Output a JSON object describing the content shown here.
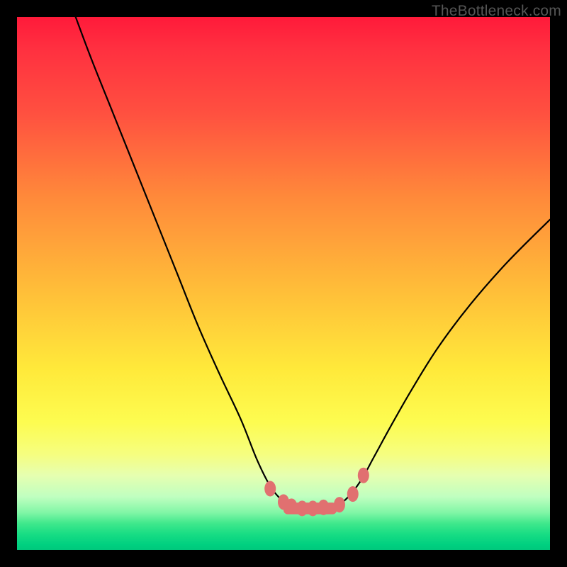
{
  "watermark": "TheBottleneck.com",
  "chart_data": {
    "type": "line",
    "title": "",
    "xlabel": "",
    "ylabel": "",
    "xlim": [
      0,
      100
    ],
    "ylim": [
      0,
      100
    ],
    "grid": false,
    "legend": false,
    "series": [
      {
        "name": "left-curve",
        "x": [
          11,
          14,
          18,
          22,
          26,
          30,
          34,
          38,
          42,
          45,
          47.5,
          49.5,
          51
        ],
        "y": [
          100,
          92,
          82,
          72,
          62,
          52,
          42,
          33,
          24.5,
          17,
          12,
          9.5,
          8.2
        ]
      },
      {
        "name": "right-curve",
        "x": [
          60,
          62,
          64.5,
          67,
          70,
          74,
          79,
          85,
          92,
          100
        ],
        "y": [
          8.2,
          9.8,
          13,
          17.5,
          23,
          30,
          38,
          46,
          54,
          62
        ]
      },
      {
        "name": "trough-markers",
        "x": [
          47.5,
          50,
          51.5,
          53.5,
          55.5,
          57.5,
          60.5,
          63,
          65
        ],
        "y": [
          11.5,
          9,
          8.2,
          7.8,
          7.8,
          8,
          8.5,
          10.5,
          14
        ]
      }
    ],
    "trough_bar": {
      "x_start": 50,
      "x_end": 60,
      "y": 7.8,
      "height": 2.2
    }
  }
}
